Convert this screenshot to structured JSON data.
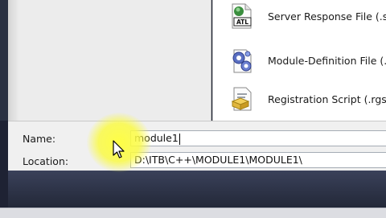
{
  "templates": [
    {
      "label": "Server Response File (.srf)",
      "icon": "atl-file-icon"
    },
    {
      "label": "Module-Definition File (.def)",
      "icon": "module-definition-icon"
    },
    {
      "label": "Registration Script (.rgs)",
      "icon": "registration-script-icon"
    }
  ],
  "form": {
    "name_label": "Name:",
    "name_value": "module1",
    "location_label": "Location:",
    "location_value": "D:\\ITB\\C++\\MODULE1\\MODULE1\\"
  },
  "colors": {
    "highlight": "#ffff3c",
    "input_border": "#a5acb5",
    "form_background": "#f0f0f0"
  }
}
